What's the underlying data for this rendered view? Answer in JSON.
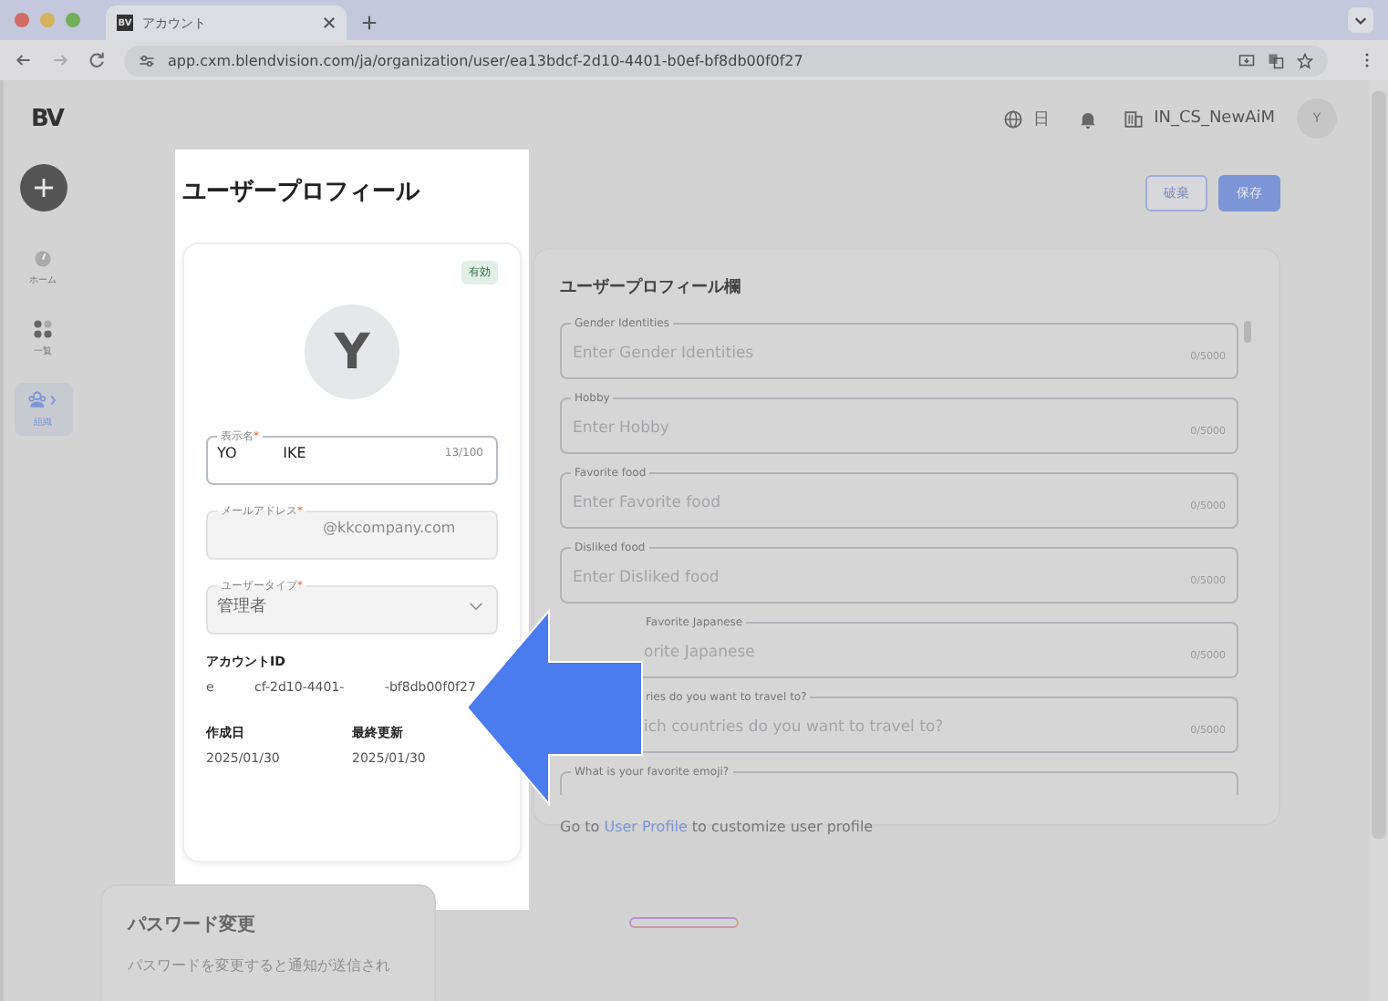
{
  "browser": {
    "tab_title": "アカウント",
    "tab_logo": "BV",
    "url": "app.cxm.blendvision.com/ja/organization/user/ea13bdcf-2d10-4401-b0ef-bf8db00f0f27"
  },
  "header": {
    "logo": "BV",
    "language": "日",
    "organization": "IN_CS_NewAiM",
    "avatar": "Y"
  },
  "sidebar": {
    "items": [
      {
        "label": "ホーム",
        "kind": "home",
        "selected": false
      },
      {
        "label": "一覧",
        "kind": "grid",
        "selected": false
      },
      {
        "label": "組織",
        "kind": "people",
        "selected": true
      }
    ]
  },
  "actions": [
    {
      "label": "破棄",
      "kind": "secondary"
    },
    {
      "label": "保存",
      "kind": "primary"
    }
  ],
  "profile": {
    "title": "ユーザープロフィール",
    "status": "有効",
    "avatar": "Y",
    "fields": [
      {
        "kind": "text",
        "label": "表示名",
        "required_mark": "*",
        "value": "YO          IKE",
        "counter": "13/100"
      },
      {
        "kind": "readonly",
        "label": "メールアドレス",
        "required_mark": "*",
        "value": "@kkcompany.com"
      },
      {
        "kind": "select",
        "label": "ユーザータイプ",
        "required_mark": "*",
        "value": "管理者"
      }
    ],
    "account_id_label": "アカウントID",
    "account_id": "e          cf-2d10-4401-          -bf8db00f0f27",
    "created_label": "作成日",
    "created": "2025/01/30",
    "updated_label": "最終更新",
    "updated": "2025/01/30"
  },
  "custom_fields": {
    "title": "ユーザープロフィール欄",
    "fields": [
      {
        "label": "Gender Identities",
        "placeholder": "Enter Gender Identities",
        "counter": "0/5000",
        "covered": false
      },
      {
        "label": "Hobby",
        "placeholder": "Enter Hobby",
        "counter": "0/5000",
        "covered": false
      },
      {
        "label": "Favorite food",
        "placeholder": "Enter Favorite food",
        "counter": "0/5000",
        "covered": false
      },
      {
        "label": "Disliked food",
        "placeholder": "Enter Disliked food",
        "counter": "0/5000",
        "covered": false
      },
      {
        "label": "Favorite Japanese",
        "placeholder": "orite Japanese",
        "counter": "0/5000",
        "covered": true
      },
      {
        "label": "ries do you want to travel to?",
        "placeholder": "ich countries do you want to travel to?",
        "counter": "0/5000",
        "covered": true
      },
      {
        "label": "What is your favorite emoji?",
        "covered": false
      }
    ],
    "footer": {
      "before": "Go to",
      "link": "User Profile",
      "after": "to customize user profile"
    }
  },
  "password": {
    "title": "パスワード変更",
    "description": "パスワードを変更すると通知が送信され"
  }
}
